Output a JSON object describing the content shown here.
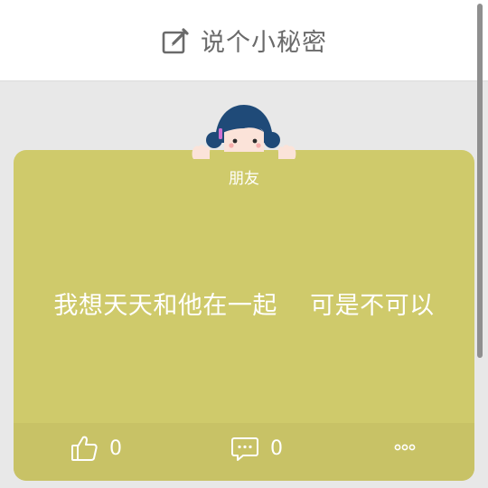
{
  "header": {
    "title": "说个小秘密",
    "icon": "compose-icon"
  },
  "card": {
    "background_color": "#cfca6b",
    "author": "朋友",
    "text": "我想天天和他在一起    可是不可以",
    "like_count": "0",
    "comment_count": "0",
    "icons": {
      "like": "thumbs-up-icon",
      "comment": "comment-icon",
      "more": "more-icon"
    }
  }
}
